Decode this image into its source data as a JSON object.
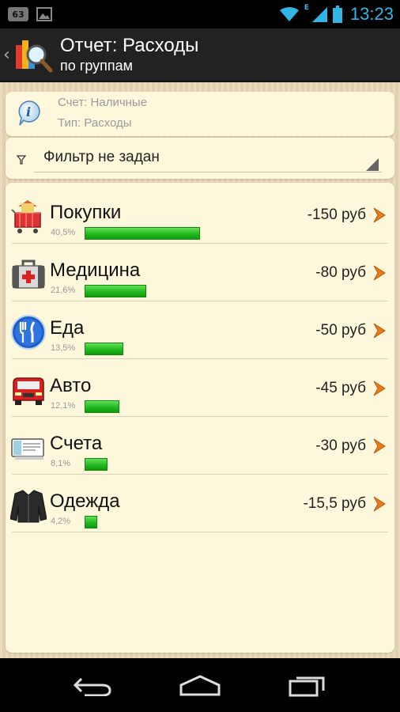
{
  "status_bar": {
    "notification_count": "63",
    "network_type": "E",
    "time": "13:23",
    "accent_color": "#33b5e5"
  },
  "action_bar": {
    "title": "Отчет: Расходы",
    "subtitle": "по группам"
  },
  "info": {
    "account_line": "Счет: Наличные",
    "type_line": "Тип: Расходы"
  },
  "filter": {
    "label": "Фильтр не задан"
  },
  "groups": [
    {
      "name": "Покупки",
      "percent": "40,5%",
      "share": 0.405,
      "amount": "-150 руб",
      "icon": "shopping-basket-icon"
    },
    {
      "name": "Медицина",
      "percent": "21,6%",
      "share": 0.216,
      "amount": "-80 руб",
      "icon": "medical-kit-icon"
    },
    {
      "name": "Еда",
      "percent": "13,5%",
      "share": 0.135,
      "amount": "-50 руб",
      "icon": "fork-knife-icon"
    },
    {
      "name": "Авто",
      "percent": "12,1%",
      "share": 0.121,
      "amount": "-45 руб",
      "icon": "car-icon"
    },
    {
      "name": "Счета",
      "percent": "8,1%",
      "share": 0.081,
      "amount": "-30 руб",
      "icon": "bill-icon"
    },
    {
      "name": "Одежда",
      "percent": "4,2%",
      "share": 0.042,
      "amount": "-15,5 руб",
      "icon": "jacket-icon"
    }
  ],
  "colors": {
    "bar_green": "#1fb61b",
    "arrow_orange": "#e87a1a",
    "card_bg": "#fdf8dc",
    "background": "#e9d7b6"
  }
}
